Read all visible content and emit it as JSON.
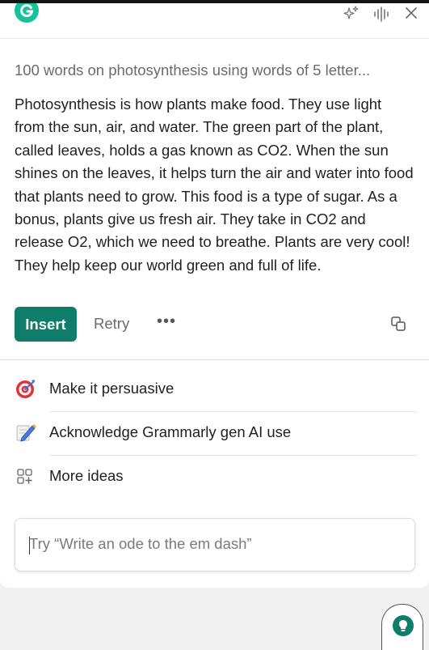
{
  "app": {
    "name": "Grammarly",
    "colors": {
      "brand": "#15c39a",
      "accent": "#0e7d6a",
      "text": "#1f1f1f",
      "muted": "#6b6b6b"
    }
  },
  "header": {
    "icons": [
      "grammarly-logo-icon",
      "sparkle-icon",
      "audio-wave-icon",
      "close-icon"
    ]
  },
  "response": {
    "prompt_title": "100 words on photosynthesis using words of 5 letter...",
    "text": "Photosynthesis is how plants make food. They use light from the sun, air, and water. The green part of the plant, called leaves, holds a gas known as CO2. When the sun shines on the leaves, it helps turn the air and water into food that plants need to grow. This food is a type of sugar. As a bonus, plants give us fresh air. They take in CO2 and release O2, which we need to breathe. Plants are very cool! They help keep our world green and full of life."
  },
  "actions": {
    "insert_label": "Insert",
    "retry_label": "Retry",
    "more_label": "•••"
  },
  "suggestions": [
    {
      "label": "Make it persuasive",
      "icon": "target-icon"
    },
    {
      "label": "Acknowledge Grammarly gen AI use",
      "icon": "pen-icon"
    },
    {
      "label": "More ideas",
      "icon": "grid-plus-icon"
    }
  ],
  "input": {
    "placeholder": "Try “Write an ode to the em dash”"
  },
  "assistant_button": {
    "icon": "lightbulb-icon"
  }
}
